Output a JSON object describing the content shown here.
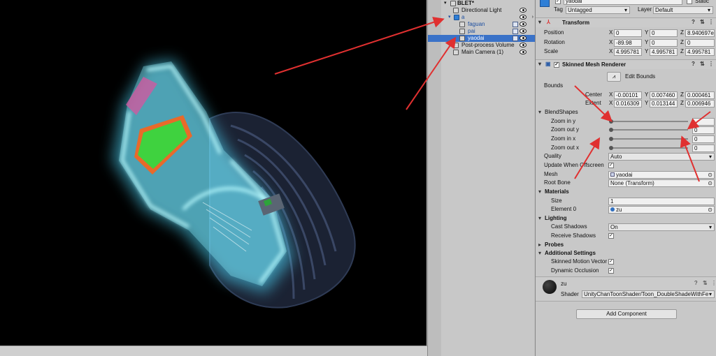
{
  "hierarchy": {
    "root": "BLET*",
    "items": [
      {
        "label": "Directional Light"
      },
      {
        "label": "a"
      },
      {
        "label": "faguan"
      },
      {
        "label": "pai"
      },
      {
        "label": "yaodai"
      },
      {
        "label": "Post-process Volume"
      },
      {
        "label": "Main Camera (1)"
      }
    ]
  },
  "inspector": {
    "object_name": "yaodai",
    "static_label": "Static",
    "tag_label": "Tag",
    "tag_value": "Untagged",
    "layer_label": "Layer",
    "layer_value": "Default",
    "transform": {
      "title": "Transform",
      "position": {
        "label": "Position",
        "x": "0",
        "y": "0",
        "z": "8.940697e"
      },
      "rotation": {
        "label": "Rotation",
        "x": "-89.98",
        "y": "0",
        "z": "0"
      },
      "scale": {
        "label": "Scale",
        "x": "4.995781",
        "y": "4.995781",
        "z": "4.995781"
      }
    },
    "smr": {
      "title": "Skinned Mesh Renderer",
      "edit_bounds": "Edit Bounds",
      "bounds_label": "Bounds",
      "center_label": "Center",
      "center": {
        "x": "-0.00101",
        "y": "0.007460",
        "z": "0.000461"
      },
      "extent_label": "Extent",
      "extent": {
        "x": "0.016309",
        "y": "0.013144",
        "z": "0.006946"
      },
      "blendshapes_label": "BlendShapes",
      "blendshapes": [
        {
          "label": "Zoom in y",
          "value": ""
        },
        {
          "label": "Zoom out y",
          "value": "0"
        },
        {
          "label": "Zoom in x",
          "value": "0"
        },
        {
          "label": "Zoom out x",
          "value": "0"
        }
      ],
      "quality_label": "Quality",
      "quality_value": "Auto",
      "update_offscreen_label": "Update When Offscreen",
      "mesh_label": "Mesh",
      "mesh_value": "yaodai",
      "root_bone_label": "Root Bone",
      "root_bone_value": "None (Transform)",
      "materials_label": "Materials",
      "size_label": "Size",
      "size_value": "1",
      "element0_label": "Element 0",
      "element0_value": "zu",
      "lighting_label": "Lighting",
      "cast_shadows_label": "Cast Shadows",
      "cast_shadows_value": "On",
      "receive_shadows_label": "Receive Shadows",
      "probes_label": "Probes",
      "additional_label": "Additional Settings",
      "motion_vector_label": "Skinned Motion Vector",
      "dynamic_occlusion_label": "Dynamic Occlusion"
    },
    "material": {
      "name": "zu",
      "shader_label": "Shader",
      "shader_value": "UnityChanToonShader/Toon_DoubleShadeWithFe"
    },
    "add_component": "Add Component"
  },
  "colors": {
    "selection": "#3a72c8",
    "arrow": "#e03030",
    "glow": "#5ff0ff",
    "screen_green": "#3fd23f"
  }
}
